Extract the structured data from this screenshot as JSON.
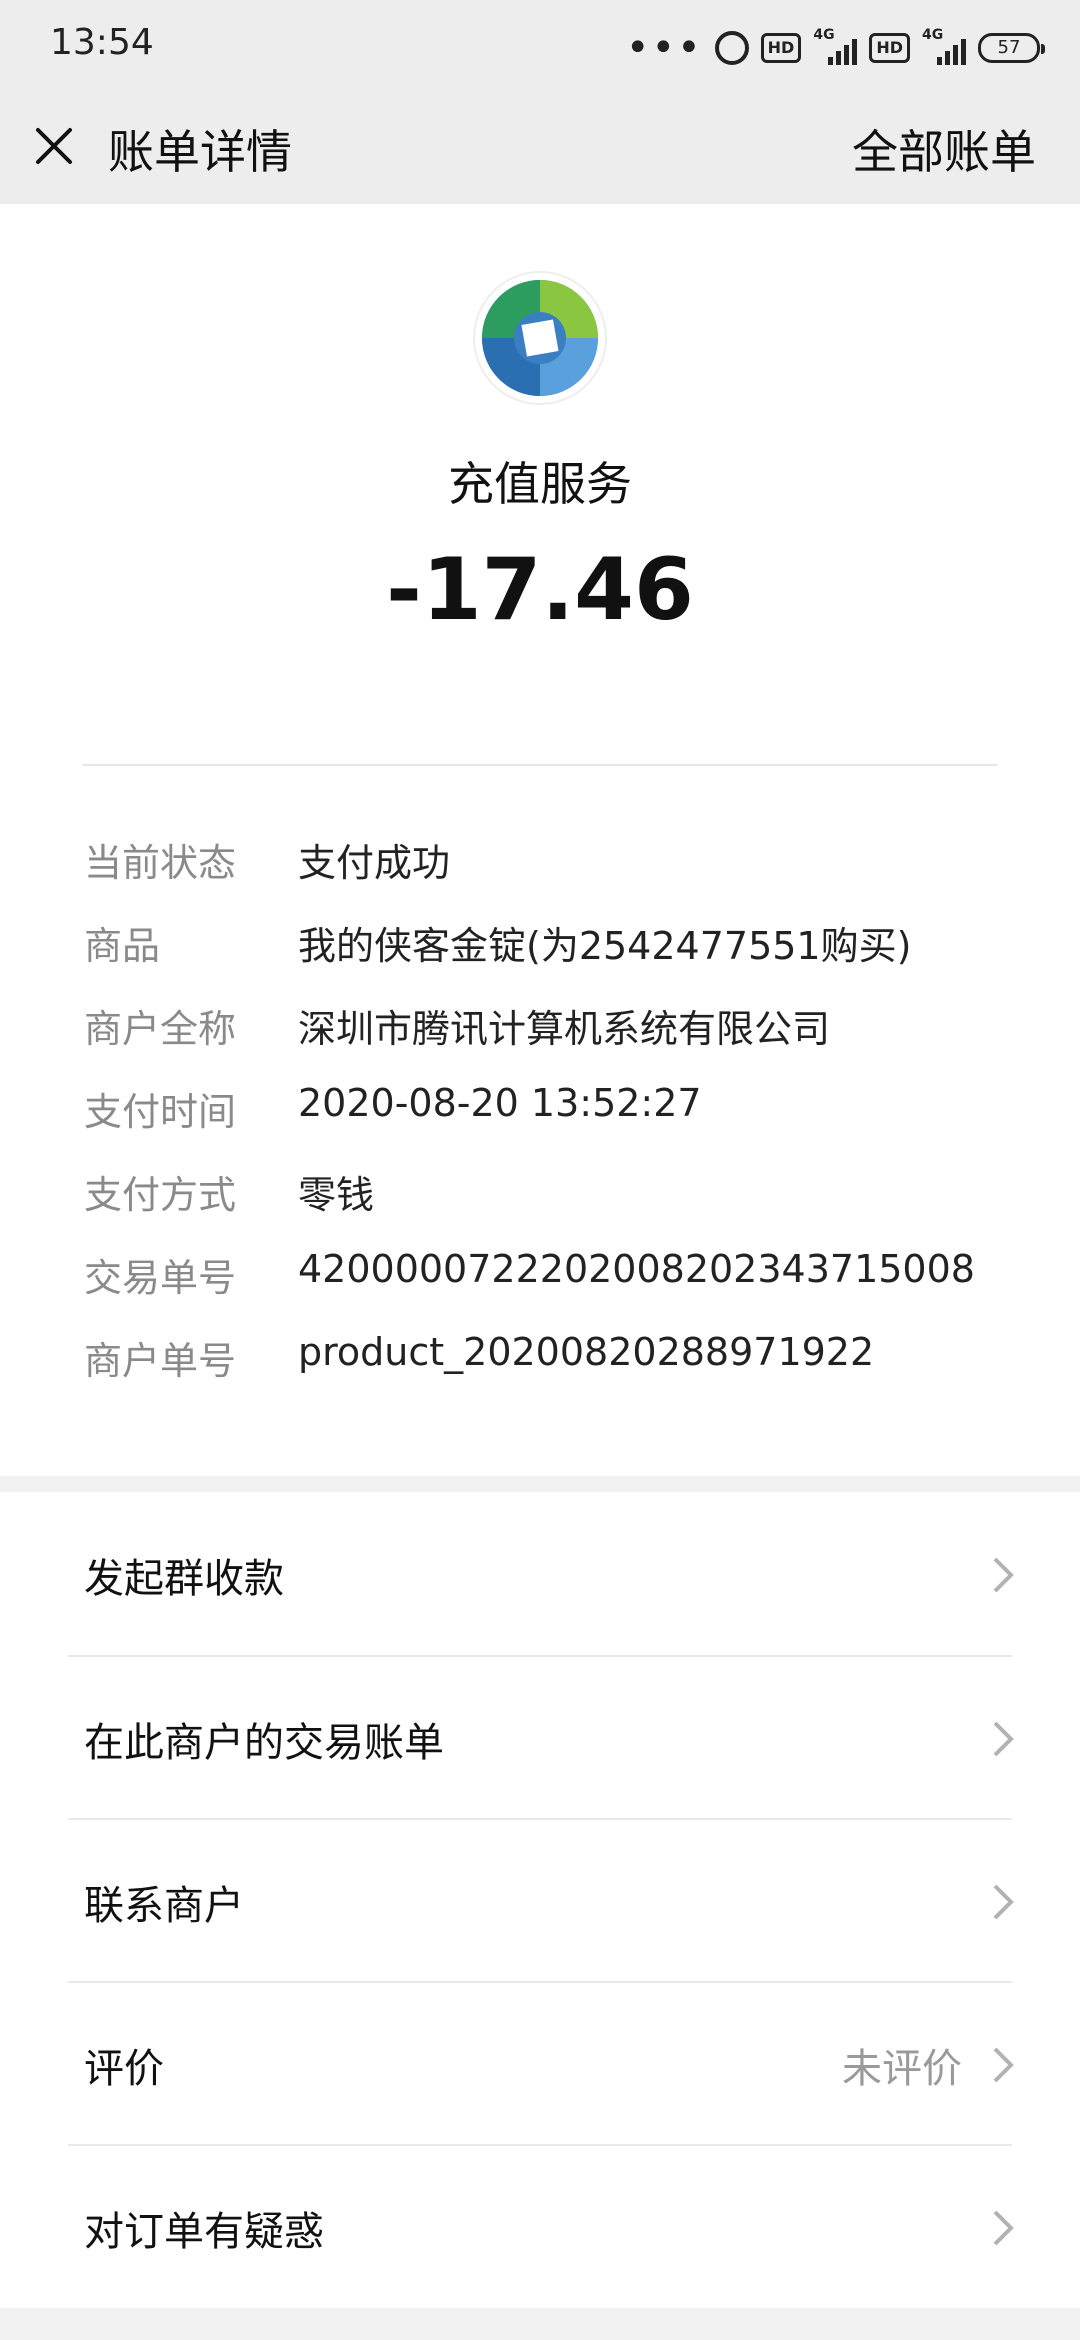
{
  "status_bar": {
    "time": "13:54",
    "dots": "•••",
    "hd": "HD",
    "network1": "4G",
    "network2": "4G",
    "battery": "57"
  },
  "nav": {
    "close_icon": "close-icon",
    "title": "账单详情",
    "right_link": "全部账单"
  },
  "merchant": {
    "logo_icon": "merchant-logo",
    "name": "充值服务",
    "amount": "-17.46"
  },
  "details": [
    {
      "label": "当前状态",
      "value": "支付成功"
    },
    {
      "label": "商品",
      "value": "我的侠客金锭(为2542477551购买)"
    },
    {
      "label": "商户全称",
      "value": "深圳市腾讯计算机系统有限公司"
    },
    {
      "label": "支付时间",
      "value": "2020-08-20 13:52:27"
    },
    {
      "label": "支付方式",
      "value": "零钱"
    },
    {
      "label": "交易单号",
      "value": "4200000722202008202343715008"
    },
    {
      "label": "商户单号",
      "value": "product_20200820288971922"
    }
  ],
  "actions": [
    {
      "label": "发起群收款",
      "value": ""
    },
    {
      "label": "在此商户的交易账单",
      "value": ""
    },
    {
      "label": "联系商户",
      "value": ""
    },
    {
      "label": "评价",
      "value": "未评价"
    },
    {
      "label": "对订单有疑惑",
      "value": ""
    }
  ],
  "colors": {
    "background": "#ededed",
    "card": "#ffffff",
    "label_gray": "#8a8a8a"
  }
}
